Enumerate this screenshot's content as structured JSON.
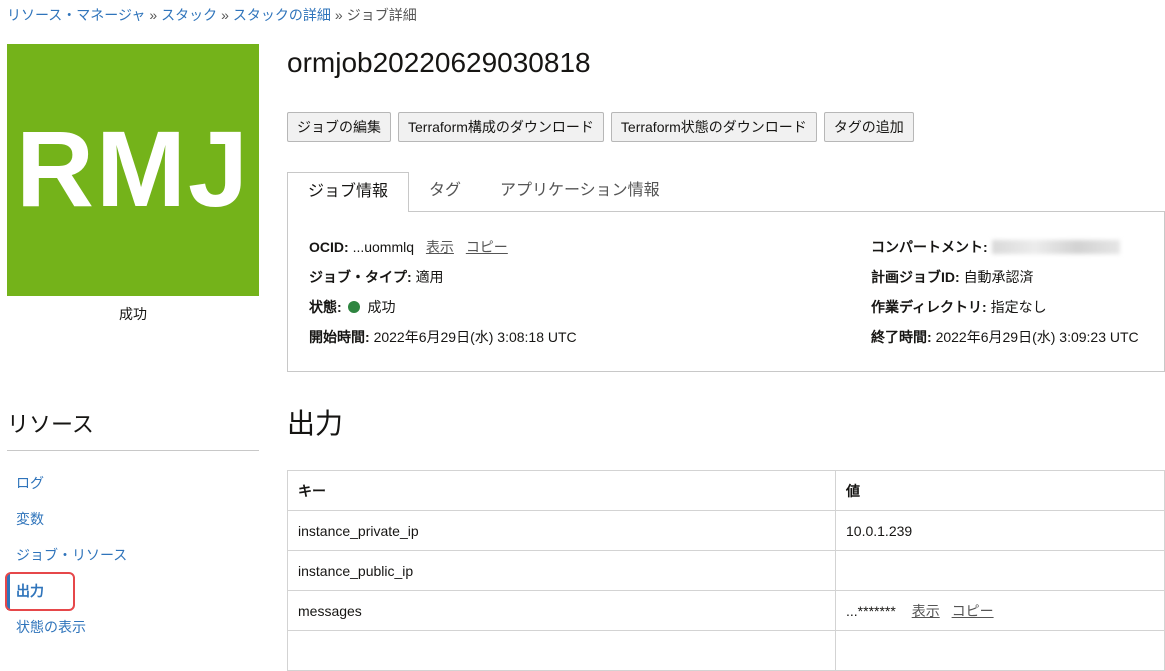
{
  "breadcrumb": {
    "items": [
      "リソース・マネージャ",
      "スタック",
      "スタックの詳細"
    ],
    "separator": "»",
    "current": "ジョブ詳細"
  },
  "logo": {
    "text": "RMJ",
    "color": "#74b31a",
    "status": "成功"
  },
  "job": {
    "title": "ormjob20220629030818"
  },
  "actions": [
    "ジョブの編集",
    "Terraform構成のダウンロード",
    "Terraform状態のダウンロード",
    "タグの追加"
  ],
  "tabs": [
    {
      "label": "ジョブ情報",
      "active": true
    },
    {
      "label": "タグ",
      "active": false
    },
    {
      "label": "アプリケーション情報",
      "active": false
    }
  ],
  "info": {
    "ocid": {
      "label": "OCID:",
      "value": "...uommlq",
      "show": "表示",
      "copy": "コピー"
    },
    "job_type": {
      "label": "ジョブ・タイプ:",
      "value": "適用"
    },
    "state": {
      "label": "状態:",
      "value": "成功",
      "color": "#2e8540"
    },
    "start_time": {
      "label": "開始時間:",
      "value": "2022年6月29日(水) 3:08:18 UTC"
    },
    "compartment": {
      "label": "コンパートメント:"
    },
    "plan_job_id": {
      "label": "計画ジョブID:",
      "value": "自動承認済"
    },
    "working_dir": {
      "label": "作業ディレクトリ:",
      "value": "指定なし"
    },
    "end_time": {
      "label": "終了時間:",
      "value": "2022年6月29日(水) 3:09:23 UTC"
    }
  },
  "resources": {
    "title": "リソース",
    "items": [
      {
        "label": "ログ",
        "active": false
      },
      {
        "label": "変数",
        "active": false
      },
      {
        "label": "ジョブ・リソース",
        "active": false
      },
      {
        "label": "出力",
        "active": true
      },
      {
        "label": "状態の表示",
        "active": false
      }
    ]
  },
  "outputs": {
    "title": "出力",
    "columns": [
      "キー",
      "値"
    ],
    "rows": [
      {
        "key": "instance_private_ip",
        "value": "10.0.1.239"
      },
      {
        "key": "instance_public_ip",
        "value": ""
      },
      {
        "key": "messages",
        "value": "...*******",
        "show": "表示",
        "copy": "コピー"
      }
    ]
  },
  "colors": {
    "link": "#2f74bb",
    "highlight": "#e6474a"
  }
}
